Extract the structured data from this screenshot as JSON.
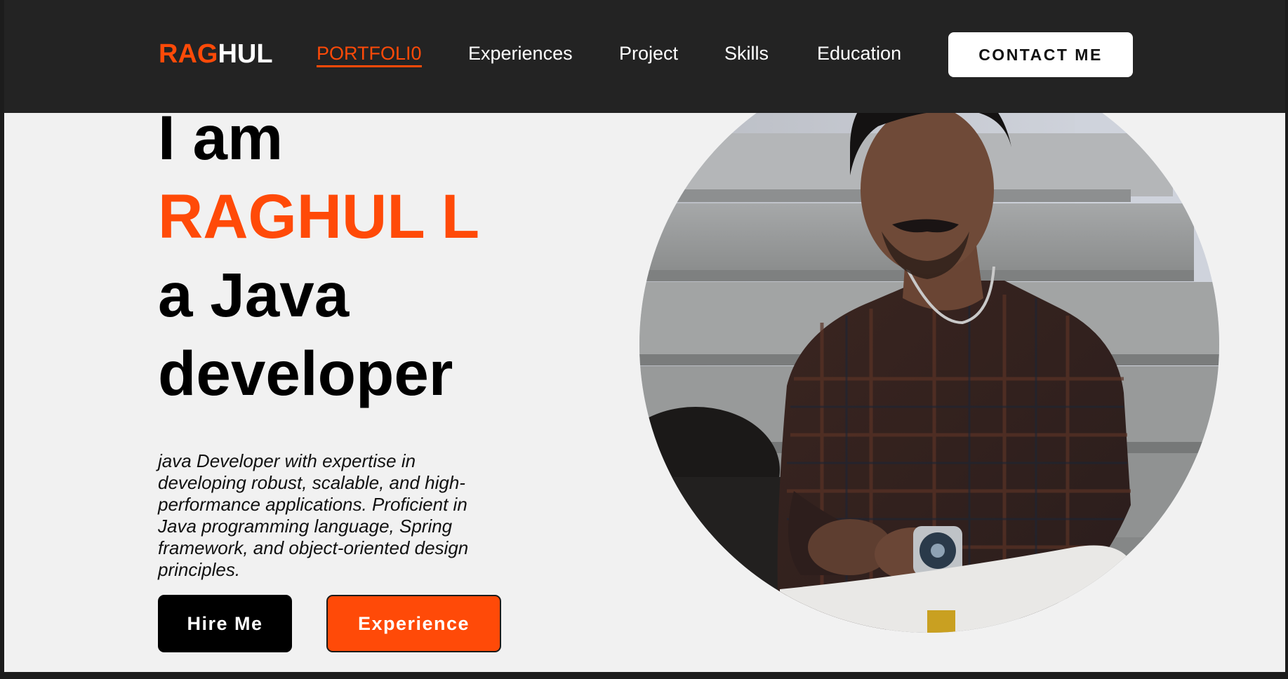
{
  "nav": {
    "logo_accent": "RAG",
    "logo_rest": "HUL",
    "links": [
      {
        "label": "PORTFOLI0",
        "active": true
      },
      {
        "label": "Experiences",
        "active": false
      },
      {
        "label": "Project",
        "active": false
      },
      {
        "label": "Skills",
        "active": false
      },
      {
        "label": "Education",
        "active": false
      }
    ],
    "contact_label": "CONTACT ME"
  },
  "hero": {
    "line1": "I am",
    "name": "RAGHUL L",
    "line3": "a Java",
    "line4": "developer",
    "description": "java Developer with expertise in developing robust, scalable, and high-performance applications. Proficient in Java programming language, Spring framework, and object-oriented design principles.",
    "hire_label": "Hire Me",
    "experience_label": "Experience"
  },
  "profile_image": {
    "subject": "person-seated-on-stone-steps"
  },
  "colors": {
    "accent": "#ff4a08",
    "navbar_bg": "#232323",
    "page_bg": "#f1f1f1"
  }
}
